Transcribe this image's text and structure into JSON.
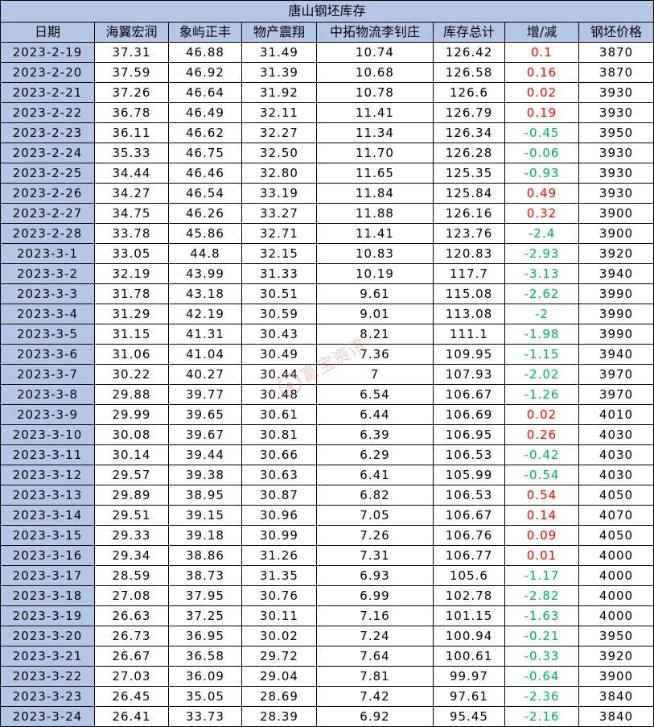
{
  "title": "唐山钢坯库存",
  "headers": [
    "日期",
    "海翼宏润",
    "象屿正丰",
    "物产震翔",
    "中拓物流李钊庄",
    "库存总计",
    "增/减",
    "钢坯价格"
  ],
  "watermark": "富宝资讯",
  "colors": {
    "header_bg": "#b4c7e7",
    "increase": "#ff0000",
    "decrease": "#00b050"
  },
  "rows": [
    [
      "2023-2-19",
      "37.31",
      "46.88",
      "31.49",
      "10.74",
      "126.42",
      "0.1",
      "3870"
    ],
    [
      "2023-2-20",
      "37.59",
      "46.92",
      "31.39",
      "10.68",
      "126.58",
      "0.16",
      "3870"
    ],
    [
      "2023-2-21",
      "37.26",
      "46.64",
      "31.92",
      "10.78",
      "126.6",
      "0.02",
      "3930"
    ],
    [
      "2023-2-22",
      "36.78",
      "46.49",
      "32.11",
      "11.41",
      "126.79",
      "0.19",
      "3930"
    ],
    [
      "2023-2-23",
      "36.11",
      "46.62",
      "32.27",
      "11.34",
      "126.34",
      "-0.45",
      "3950"
    ],
    [
      "2023-2-24",
      "35.33",
      "46.75",
      "32.50",
      "11.70",
      "126.28",
      "-0.06",
      "3930"
    ],
    [
      "2023-2-25",
      "34.44",
      "46.46",
      "32.80",
      "11.65",
      "125.35",
      "-0.93",
      "3930"
    ],
    [
      "2023-2-26",
      "34.27",
      "46.54",
      "33.19",
      "11.84",
      "125.84",
      "0.49",
      "3930"
    ],
    [
      "2023-2-27",
      "34.75",
      "46.26",
      "33.27",
      "11.88",
      "126.16",
      "0.32",
      "3900"
    ],
    [
      "2023-2-28",
      "33.78",
      "45.86",
      "32.71",
      "11.41",
      "123.76",
      "-2.4",
      "3900"
    ],
    [
      "2023-3-1",
      "33.05",
      "44.8",
      "32.15",
      "10.83",
      "120.83",
      "-2.93",
      "3920"
    ],
    [
      "2023-3-2",
      "32.19",
      "43.99",
      "31.33",
      "10.19",
      "117.7",
      "-3.13",
      "3940"
    ],
    [
      "2023-3-3",
      "31.78",
      "43.18",
      "30.51",
      "9.61",
      "115.08",
      "-2.62",
      "3990"
    ],
    [
      "2023-3-4",
      "31.29",
      "42.19",
      "30.59",
      "9.01",
      "113.08",
      "-2",
      "3990"
    ],
    [
      "2023-3-5",
      "31.15",
      "41.31",
      "30.43",
      "8.21",
      "111.1",
      "-1.98",
      "3990"
    ],
    [
      "2023-3-6",
      "31.06",
      "41.04",
      "30.49",
      "7.36",
      "109.95",
      "-1.15",
      "3940"
    ],
    [
      "2023-3-7",
      "30.22",
      "40.27",
      "30.44",
      "7",
      "107.93",
      "-2.02",
      "3970"
    ],
    [
      "2023-3-8",
      "29.88",
      "39.77",
      "30.48",
      "6.54",
      "106.67",
      "-1.26",
      "3970"
    ],
    [
      "2023-3-9",
      "29.99",
      "39.65",
      "30.61",
      "6.44",
      "106.69",
      "0.02",
      "4010"
    ],
    [
      "2023-3-10",
      "30.08",
      "39.67",
      "30.81",
      "6.39",
      "106.95",
      "0.26",
      "4030"
    ],
    [
      "2023-3-11",
      "30.14",
      "39.44",
      "30.66",
      "6.29",
      "106.53",
      "-0.42",
      "4030"
    ],
    [
      "2023-3-12",
      "29.57",
      "39.38",
      "30.63",
      "6.41",
      "105.99",
      "-0.54",
      "4030"
    ],
    [
      "2023-3-13",
      "29.89",
      "38.95",
      "30.87",
      "6.82",
      "106.53",
      "0.54",
      "4050"
    ],
    [
      "2023-3-14",
      "29.51",
      "39.15",
      "30.96",
      "7.05",
      "106.67",
      "0.14",
      "4070"
    ],
    [
      "2023-3-15",
      "29.33",
      "39.18",
      "30.99",
      "7.26",
      "106.76",
      "0.09",
      "4050"
    ],
    [
      "2023-3-16",
      "29.34",
      "38.86",
      "31.26",
      "7.31",
      "106.77",
      "0.01",
      "4000"
    ],
    [
      "2023-3-17",
      "28.59",
      "38.73",
      "31.35",
      "6.93",
      "105.6",
      "-1.17",
      "4000"
    ],
    [
      "2023-3-18",
      "27.08",
      "37.95",
      "30.76",
      "6.99",
      "102.78",
      "-2.82",
      "4000"
    ],
    [
      "2023-3-19",
      "26.63",
      "37.25",
      "30.11",
      "7.16",
      "101.15",
      "-1.63",
      "4000"
    ],
    [
      "2023-3-20",
      "26.73",
      "36.95",
      "30.02",
      "7.24",
      "100.94",
      "-0.21",
      "3950"
    ],
    [
      "2023-3-21",
      "26.67",
      "36.58",
      "29.72",
      "7.64",
      "100.61",
      "-0.33",
      "3920"
    ],
    [
      "2023-3-22",
      "27.03",
      "36.09",
      "29.04",
      "7.81",
      "99.97",
      "-0.64",
      "3900"
    ],
    [
      "2023-3-23",
      "26.45",
      "35.05",
      "28.69",
      "7.42",
      "97.61",
      "-2.36",
      "3840"
    ],
    [
      "2023-3-24",
      "26.41",
      "33.73",
      "28.39",
      "6.92",
      "95.45",
      "-2.16",
      "3840"
    ]
  ]
}
